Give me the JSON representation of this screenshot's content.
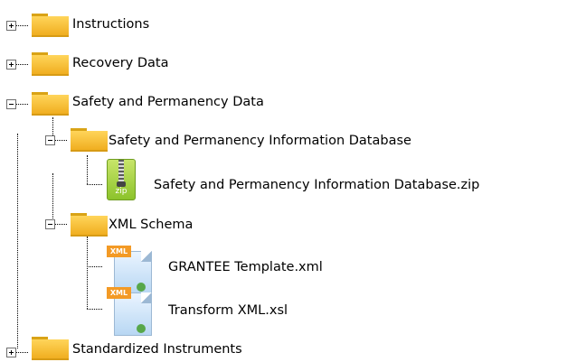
{
  "tree": {
    "instructions": {
      "label": "Instructions"
    },
    "recovery": {
      "label": "Recovery Data"
    },
    "safety": {
      "label": "Safety and Permanency Data",
      "sub_info": {
        "label": "Safety and Permanency Information Database"
      },
      "zip_file": {
        "label": "Safety and Permanency Information Database.zip",
        "icon_text": "zip"
      },
      "xml_schema": {
        "label": "XML Schema",
        "grantee": {
          "label": "GRANTEE Template.xml"
        },
        "transform": {
          "label": "Transform XML.xsl"
        },
        "xml_badge": "XML"
      }
    },
    "standardized": {
      "label": "Standardized Instruments"
    }
  }
}
